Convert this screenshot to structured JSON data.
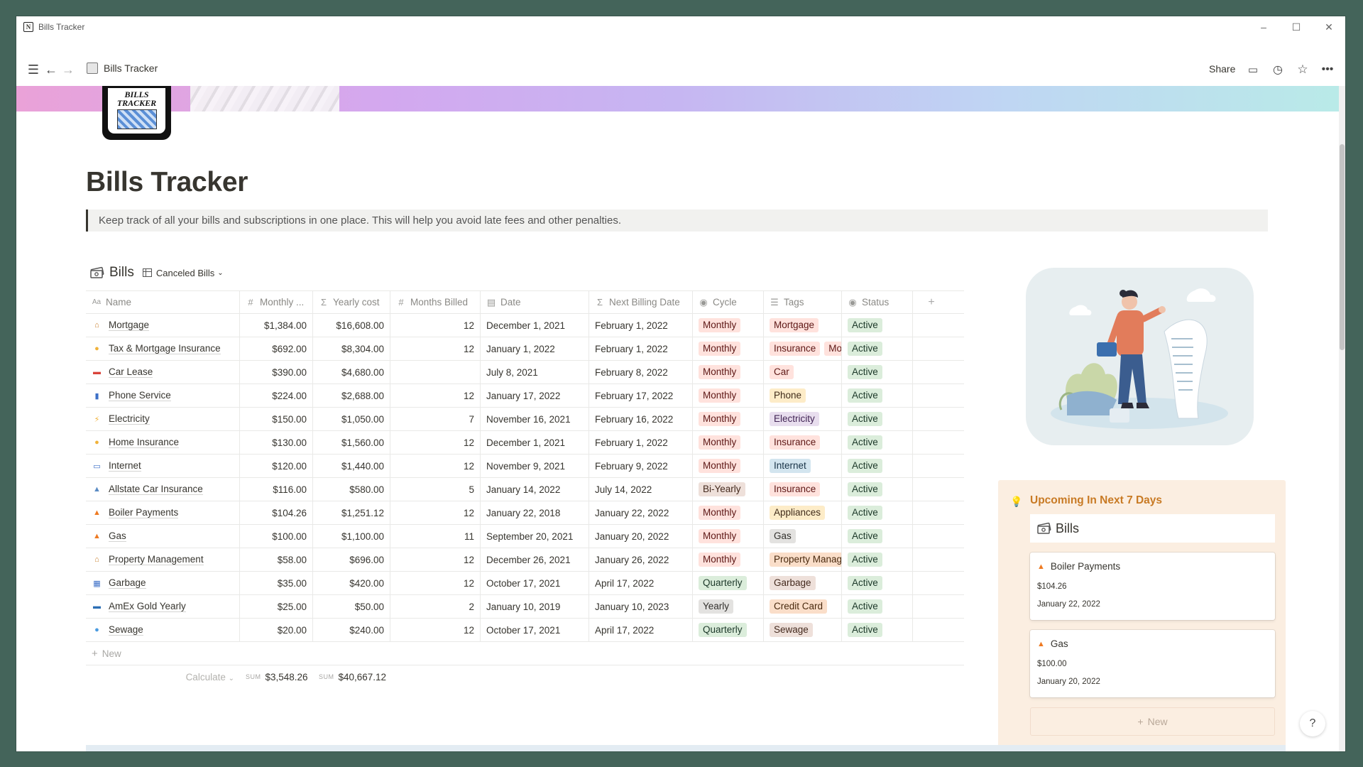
{
  "window": {
    "title": "Bills Tracker",
    "logo_letter": "N"
  },
  "topbar": {
    "breadcrumb": "Bills Tracker",
    "share_label": "Share"
  },
  "page": {
    "icon_text": "BILLS TRACKER",
    "title": "Bills Tracker",
    "callout": "Keep track of all your bills and subscriptions in one place. This will help you avoid late fees and other penalties."
  },
  "database": {
    "title": "Bills",
    "view_label": "Canceled Bills",
    "columns": [
      "Name",
      "Monthly ...",
      "Yearly cost",
      "Months Billed",
      "Date",
      "Next Billing Date",
      "Cycle",
      "Tags",
      "Status",
      "+"
    ],
    "rows": [
      {
        "icon": "house-icon",
        "glyph": "⌂",
        "color": "#c9802f",
        "name": "Mortgage",
        "monthly": "$1,384.00",
        "yearly": "$16,608.00",
        "months": "12",
        "date": "December 1, 2021",
        "next": "February 1, 2022",
        "cycle": "Monthly",
        "cycle_color": "red",
        "tags": [
          {
            "t": "Mortgage",
            "c": "red"
          }
        ],
        "status": "Active"
      },
      {
        "icon": "coin-icon",
        "glyph": "●",
        "color": "#f0b23a",
        "name": "Tax & Mortgage Insurance",
        "monthly": "$692.00",
        "yearly": "$8,304.00",
        "months": "12",
        "date": "January 1, 2022",
        "next": "February 1, 2022",
        "cycle": "Monthly",
        "cycle_color": "red",
        "tags": [
          {
            "t": "Insurance",
            "c": "red"
          },
          {
            "t": "Mortgage",
            "c": "red"
          }
        ],
        "status": "Active"
      },
      {
        "icon": "car-icon",
        "glyph": "▬",
        "color": "#d9433a",
        "name": "Car Lease",
        "monthly": "$390.00",
        "yearly": "$4,680.00",
        "months": "",
        "date": "July 8, 2021",
        "next": "February 8, 2022",
        "cycle": "Monthly",
        "cycle_color": "red",
        "tags": [
          {
            "t": "Car",
            "c": "red"
          }
        ],
        "status": "Active"
      },
      {
        "icon": "phone-icon",
        "glyph": "▮",
        "color": "#3c6fc7",
        "name": "Phone Service",
        "monthly": "$224.00",
        "yearly": "$2,688.00",
        "months": "12",
        "date": "January 17, 2022",
        "next": "February 17, 2022",
        "cycle": "Monthly",
        "cycle_color": "red",
        "tags": [
          {
            "t": "Phone",
            "c": "yellow"
          }
        ],
        "status": "Active"
      },
      {
        "icon": "lightning-icon",
        "glyph": "⚡",
        "color": "#f0b23a",
        "name": "Electricity",
        "monthly": "$150.00",
        "yearly": "$1,050.00",
        "months": "7",
        "date": "November 16, 2021",
        "next": "February 16, 2022",
        "cycle": "Monthly",
        "cycle_color": "red",
        "tags": [
          {
            "t": "Electricity",
            "c": "purple"
          }
        ],
        "status": "Active"
      },
      {
        "icon": "coin-icon",
        "glyph": "●",
        "color": "#f0b23a",
        "name": "Home Insurance",
        "monthly": "$130.00",
        "yearly": "$1,560.00",
        "months": "12",
        "date": "December 1, 2021",
        "next": "February 1, 2022",
        "cycle": "Monthly",
        "cycle_color": "red",
        "tags": [
          {
            "t": "Insurance",
            "c": "red"
          }
        ],
        "status": "Active"
      },
      {
        "icon": "laptop-icon",
        "glyph": "▭",
        "color": "#3c6fc7",
        "name": "Internet",
        "monthly": "$120.00",
        "yearly": "$1,440.00",
        "months": "12",
        "date": "November 9, 2021",
        "next": "February 9, 2022",
        "cycle": "Monthly",
        "cycle_color": "red",
        "tags": [
          {
            "t": "Internet",
            "c": "blue"
          }
        ],
        "status": "Active"
      },
      {
        "icon": "boat-icon",
        "glyph": "▲",
        "color": "#5a8bc4",
        "name": "Allstate Car Insurance",
        "monthly": "$116.00",
        "yearly": "$580.00",
        "months": "5",
        "date": "January 14, 2022",
        "next": "July 14, 2022",
        "cycle": "Bi-Yearly",
        "cycle_color": "brown",
        "tags": [
          {
            "t": "Insurance",
            "c": "red"
          }
        ],
        "status": "Active"
      },
      {
        "icon": "fire-icon",
        "glyph": "▲",
        "color": "#ee7a22",
        "name": "Boiler Payments",
        "monthly": "$104.26",
        "yearly": "$1,251.12",
        "months": "12",
        "date": "January 22, 2018",
        "next": "January 22, 2022",
        "cycle": "Monthly",
        "cycle_color": "red",
        "tags": [
          {
            "t": "Appliances",
            "c": "yellow"
          }
        ],
        "status": "Active"
      },
      {
        "icon": "fire-icon",
        "glyph": "▲",
        "color": "#ee7a22",
        "name": "Gas",
        "monthly": "$100.00",
        "yearly": "$1,100.00",
        "months": "11",
        "date": "September 20, 2021",
        "next": "January 20, 2022",
        "cycle": "Monthly",
        "cycle_color": "red",
        "tags": [
          {
            "t": "Gas",
            "c": "gray"
          }
        ],
        "status": "Active"
      },
      {
        "icon": "house-icon",
        "glyph": "⌂",
        "color": "#c9802f",
        "name": "Property Management",
        "monthly": "$58.00",
        "yearly": "$696.00",
        "months": "12",
        "date": "December 26, 2021",
        "next": "January 26, 2022",
        "cycle": "Monthly",
        "cycle_color": "red",
        "tags": [
          {
            "t": "Property Management",
            "c": "orange"
          }
        ],
        "status": "Active"
      },
      {
        "icon": "chart-icon",
        "glyph": "▦",
        "color": "#3c6fc7",
        "name": "Garbage",
        "monthly": "$35.00",
        "yearly": "$420.00",
        "months": "12",
        "date": "October 17, 2021",
        "next": "April 17, 2022",
        "cycle": "Quarterly",
        "cycle_color": "green",
        "tags": [
          {
            "t": "Garbage",
            "c": "brown"
          }
        ],
        "status": "Active"
      },
      {
        "icon": "credit-card-icon",
        "glyph": "▬",
        "color": "#2c6fb5",
        "name": "AmEx Gold Yearly",
        "monthly": "$25.00",
        "yearly": "$50.00",
        "months": "2",
        "date": "January 10, 2019",
        "next": "January 10, 2023",
        "cycle": "Yearly",
        "cycle_color": "gray",
        "tags": [
          {
            "t": "Credit Card",
            "c": "orange"
          }
        ],
        "status": "Active"
      },
      {
        "icon": "droplet-icon",
        "glyph": "●",
        "color": "#4a9be0",
        "name": "Sewage",
        "monthly": "$20.00",
        "yearly": "$240.00",
        "months": "12",
        "date": "October 17, 2021",
        "next": "April 17, 2022",
        "cycle": "Quarterly",
        "cycle_color": "green",
        "tags": [
          {
            "t": "Sewage",
            "c": "brown"
          }
        ],
        "status": "Active"
      }
    ],
    "new_label": "New",
    "calculate_label": "Calculate",
    "sum_key": "SUM",
    "sum_monthly": "$3,548.26",
    "sum_yearly": "$40,667.12"
  },
  "upcoming": {
    "title": "Upcoming In Next 7 Days",
    "db_title": "Bills",
    "cards": [
      {
        "name": "Boiler Payments",
        "amount": "$104.26",
        "date": "January 22, 2022"
      },
      {
        "name": "Gas",
        "amount": "$100.00",
        "date": "January 20, 2022"
      }
    ],
    "new_label": "New"
  },
  "help_label": "?"
}
